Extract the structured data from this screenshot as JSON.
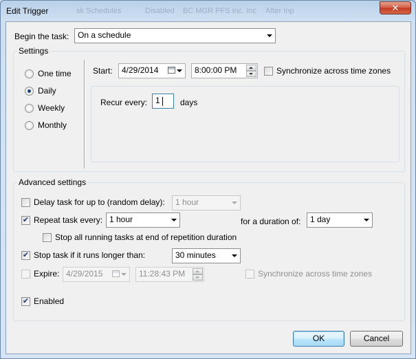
{
  "window": {
    "title": "Edit Trigger",
    "close_symbol": "✕",
    "background_ghost_texts": [
      "sk Schedules",
      "Disabled",
      "BC MGR PFS Inc. Inc",
      "After Inp"
    ]
  },
  "begin_task": {
    "label": "Begin the task:",
    "value": "On a schedule"
  },
  "settings": {
    "title": "Settings",
    "schedule_types": [
      {
        "label": "One time",
        "selected": false
      },
      {
        "label": "Daily",
        "selected": true
      },
      {
        "label": "Weekly",
        "selected": false
      },
      {
        "label": "Monthly",
        "selected": false
      }
    ],
    "start_label": "Start:",
    "start_date": "4/29/2014",
    "start_time": "8:00:00 PM",
    "sync_label": "Synchronize across time zones",
    "sync_checked": false,
    "recur_label": "Recur every:",
    "recur_value": "1",
    "recur_unit": "days"
  },
  "advanced": {
    "title": "Advanced settings",
    "delay": {
      "label": "Delay task for up to (random delay):",
      "checked": false,
      "value": "1 hour"
    },
    "repeat": {
      "label": "Repeat task every:",
      "checked": true,
      "value": "1 hour",
      "duration_label": "for a duration of:",
      "duration_value": "1 day"
    },
    "stop_running": {
      "label": "Stop all running tasks at end of repetition duration",
      "checked": false
    },
    "stop_longer": {
      "label": "Stop task if it runs longer than:",
      "checked": true,
      "value": "30 minutes"
    },
    "expire": {
      "label": "Expire:",
      "checked": false,
      "date": "4/29/2015",
      "time": "11:28:43 PM",
      "sync_label": "Synchronize across time zones",
      "sync_checked": false
    },
    "enabled": {
      "label": "Enabled",
      "checked": true
    }
  },
  "buttons": {
    "ok": "OK",
    "cancel": "Cancel"
  },
  "check_mark": "✔"
}
